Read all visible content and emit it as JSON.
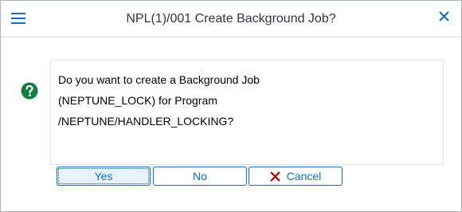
{
  "dialog": {
    "title": "NPL(1)/001 Create Background Job?",
    "message_lines": [
      "Do you want to create a Background Job",
      "(NEPTUNE_LOCK) for Program",
      "/NEPTUNE/HANDLER_LOCKING?"
    ],
    "status_icon": "question-icon",
    "menu_icon": "hamburger-menu-icon",
    "close_icon": "close-icon"
  },
  "buttons": {
    "yes": "Yes",
    "no": "No",
    "cancel": "Cancel",
    "cancel_icon": "cancel-x-icon"
  },
  "colors": {
    "accent": "#0a6ed1",
    "question": "#107e3e",
    "cancel_icon": "#bb0000"
  }
}
